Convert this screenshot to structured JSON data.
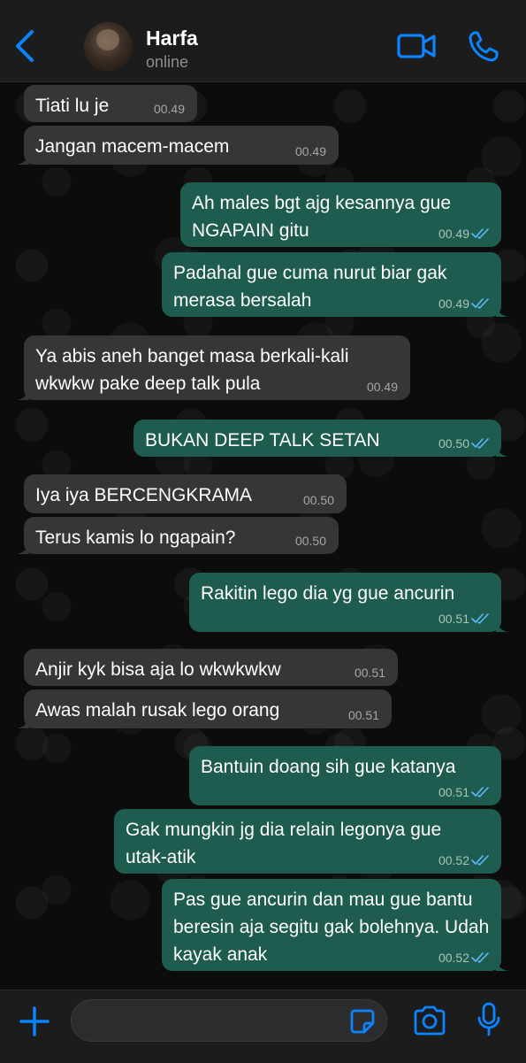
{
  "header": {
    "contact_name": "Harfa",
    "status": "online",
    "back_icon": "chevron-left-icon",
    "video_icon": "video-camera-icon",
    "call_icon": "phone-icon"
  },
  "colors": {
    "incoming_bubble": "#363638",
    "outgoing_bubble": "#1d5c4e",
    "accent_blue": "#0a84ff",
    "read_ticks": "#5fb8ff"
  },
  "messages": [
    {
      "dir": "in",
      "text": "Tiati lu je",
      "time": "00.49"
    },
    {
      "dir": "in",
      "text": "Jangan macem-macem",
      "time": "00.49"
    },
    {
      "dir": "out",
      "text": "Ah males bgt ajg kesannya gue\nNGAPAIN gitu",
      "time": "00.49"
    },
    {
      "dir": "out",
      "text": "Padahal gue cuma nurut biar gak\nmerasa bersalah",
      "time": "00.49"
    },
    {
      "dir": "in",
      "text": "Ya abis aneh banget masa berkali-kali\nwkwkw pake deep talk pula",
      "time": "00.49"
    },
    {
      "dir": "out",
      "text": "BUKAN DEEP TALK SETAN",
      "time": "00.50"
    },
    {
      "dir": "in",
      "text": "Iya iya BERCENGKRAMA",
      "time": "00.50"
    },
    {
      "dir": "in",
      "text": "Terus kamis lo ngapain?",
      "time": "00.50"
    },
    {
      "dir": "out",
      "text": "Rakitin lego dia yg gue ancurin",
      "time": "00.51"
    },
    {
      "dir": "in",
      "text": "Anjir kyk bisa aja lo wkwkwkw",
      "time": "00.51"
    },
    {
      "dir": "in",
      "text": "Awas malah rusak lego orang",
      "time": "00.51"
    },
    {
      "dir": "out",
      "text": "Bantuin doang sih gue katanya",
      "time": "00.51"
    },
    {
      "dir": "out",
      "text": "Gak mungkin jg dia relain legonya gue\nutak-atik",
      "time": "00.52"
    },
    {
      "dir": "out",
      "text": "Pas gue ancurin dan mau gue bantu\nberesin aja segitu gak bolehnya. Udah\nkayak anak",
      "time": "00.52"
    }
  ],
  "composer": {
    "placeholder": "",
    "plus_icon": "plus-icon",
    "sticker_icon": "sticker-icon",
    "camera_icon": "camera-icon",
    "mic_icon": "microphone-icon"
  }
}
